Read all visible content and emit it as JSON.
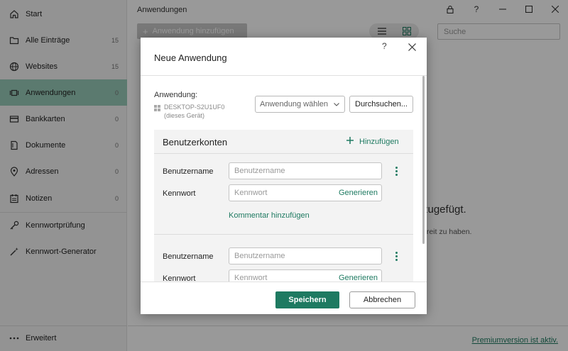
{
  "sidebar": {
    "items": [
      {
        "label": "Start",
        "count": "",
        "icon": "home-icon"
      },
      {
        "label": "Alle Einträge",
        "count": "15",
        "icon": "folder-icon"
      },
      {
        "label": "Websites",
        "count": "15",
        "icon": "globe-icon"
      },
      {
        "label": "Anwendungen",
        "count": "0",
        "icon": "application-icon",
        "active": true
      },
      {
        "label": "Bankkarten",
        "count": "0",
        "icon": "card-icon"
      },
      {
        "label": "Dokumente",
        "count": "0",
        "icon": "document-icon"
      },
      {
        "label": "Adressen",
        "count": "0",
        "icon": "location-pin-icon"
      },
      {
        "label": "Notizen",
        "count": "0",
        "icon": "note-icon"
      },
      {
        "label": "Kennwortprüfung",
        "count": "",
        "icon": "key-icon"
      },
      {
        "label": "Kennwort-Generator",
        "count": "",
        "icon": "magic-wand-icon"
      }
    ],
    "advanced_label": "Erweitert"
  },
  "main": {
    "title": "Anwendungen",
    "add_button_label": "Anwendung hinzufügen",
    "search_placeholder": "Suche",
    "empty_title_fragment": "zugefügt.",
    "empty_sub_fragment": "ereit zu haben.",
    "premium_link": "Premiumversion ist aktiv."
  },
  "dialog": {
    "help_label": "?",
    "title": "Neue Anwendung",
    "app_label": "Anwendung:",
    "device_name": "DESKTOP-S2U1UF0",
    "device_note": "(dieses Gerät)",
    "select_label": "Anwendung wählen",
    "browse_label": "Durchsuchen...",
    "accounts_title": "Benutzerkonten",
    "add_label": "Hinzufügen",
    "entries": [
      {
        "username_label": "Benutzername",
        "username_placeholder": "Benutzername",
        "password_label": "Kennwort",
        "password_placeholder": "Kennwort",
        "generate_label": "Generieren",
        "comment_label": "Kommentar hinzufügen"
      },
      {
        "username_label": "Benutzername",
        "username_placeholder": "Benutzername",
        "password_label": "Kennwort",
        "password_placeholder": "Kennwort",
        "generate_label": "Generieren"
      }
    ],
    "save_label": "Speichern",
    "cancel_label": "Abbrechen"
  },
  "colors": {
    "accent": "#1e7a61",
    "active_nav": "#98cbb9",
    "overlay": "rgba(0,0,0,0.4)"
  }
}
